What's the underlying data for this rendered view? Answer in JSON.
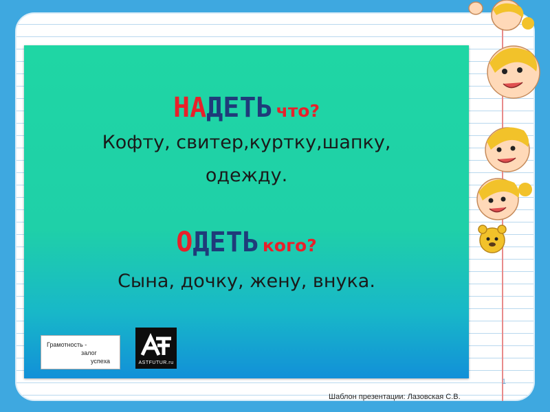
{
  "slide": {
    "verb1": {
      "highlight": "НА",
      "rest": "ДЕТЬ",
      "question": "что?"
    },
    "line1": "Кофту, свитер,куртку,шапку,",
    "line2": "одежду.",
    "verb2": {
      "highlight": "О",
      "rest": "ДЕТЬ",
      "question": "кого?"
    },
    "line3": "Сына, дочку, жену, внука."
  },
  "logo1": {
    "w1": "Грамотность -",
    "w2": "залог",
    "w3": "успеха"
  },
  "logo2": {
    "caption": "ASTFUTUR.ru"
  },
  "slide_number": "1",
  "credit": "Шаблон презентации: Лазовская С.В.",
  "colors": {
    "background": "#3ea8e0",
    "slide_top": "#1fd6a4",
    "slide_bottom": "#1290d8",
    "accent_red": "#e8202a",
    "verb_blue": "#1f3b7a"
  },
  "icons": [
    "cartoon-kids-illustration",
    "astfutur-logo-icon"
  ]
}
